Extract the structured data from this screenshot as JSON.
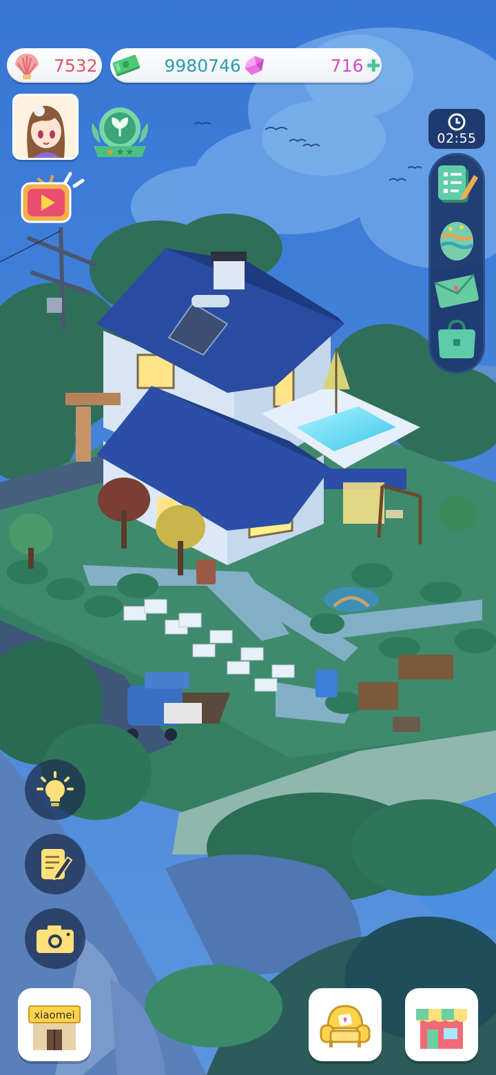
{
  "hud": {
    "shells": "7532",
    "cash": "9980746",
    "gems": "716",
    "timer": "02:55"
  },
  "shop": {
    "sign": "xiaomei"
  },
  "icons": {
    "shell": "shell-icon",
    "cash": "cash-icon",
    "gem": "gem-icon",
    "add": "plus-icon",
    "avatar": "player-avatar",
    "badge": "leaf-badge-icon",
    "tv": "video-ad-icon",
    "clock": "clock-icon",
    "tasks": "task-list-icon",
    "egg": "easter-egg-icon",
    "mail": "mail-icon",
    "bag": "bag-icon",
    "hint": "lightbulb-icon",
    "notes": "notepad-icon",
    "camera": "camera-icon",
    "sofa": "sofa-icon",
    "store": "store-icon"
  },
  "colors": {
    "shells_text": "#e0566b",
    "cash_text": "#2a9bb0",
    "gems_text": "#cf4dbd",
    "panel": "#1f3a6e",
    "sky": "#3a78d8"
  }
}
